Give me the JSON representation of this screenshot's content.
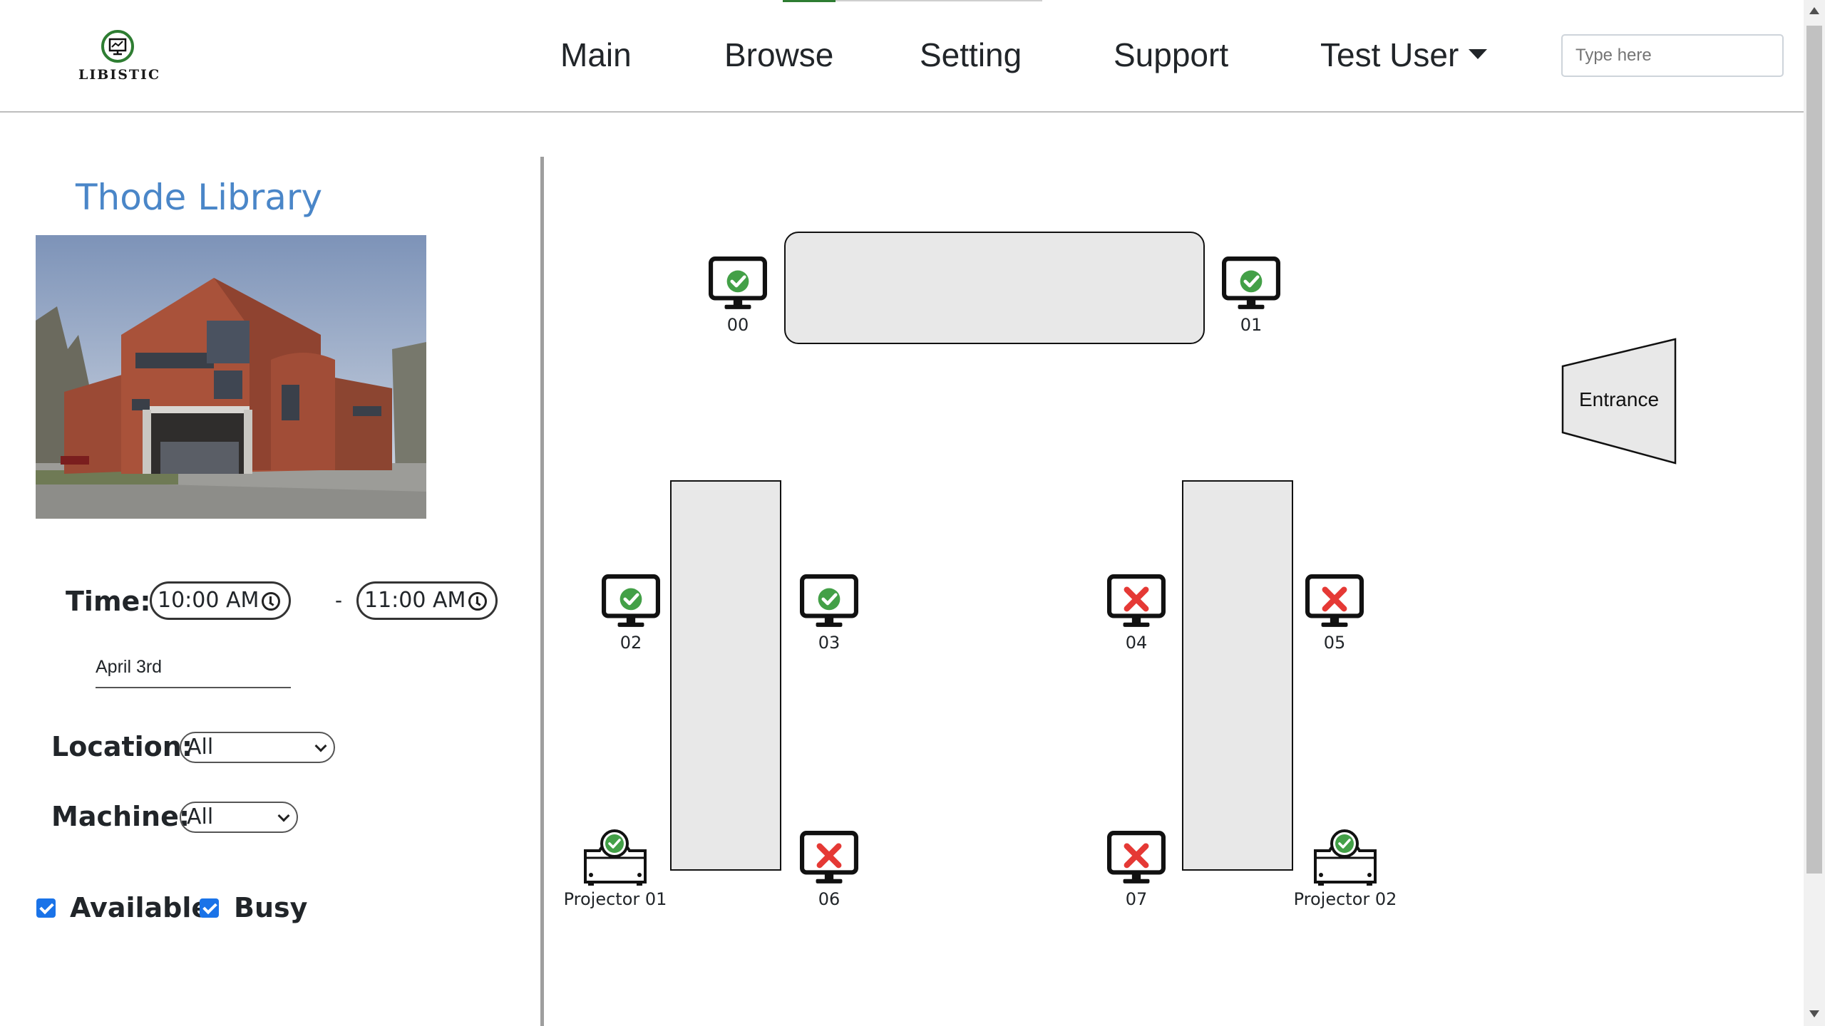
{
  "app": {
    "logo_text": "LIBISTIC"
  },
  "nav": {
    "items": [
      "Main",
      "Browse",
      "Setting",
      "Support"
    ],
    "user": "Test User",
    "search_placeholder": "Type here"
  },
  "library": {
    "name": "Thode Library"
  },
  "filters": {
    "time_label": "Time:",
    "start_time": "10:00 AM",
    "separator": "-",
    "end_time": "11:00 AM",
    "date": "April 3rd",
    "location_label": "Location:",
    "location_value": "All",
    "machine_label": "Machine:",
    "machine_value": "All",
    "available_label": "Available",
    "available_checked": true,
    "busy_label": "Busy",
    "busy_checked": true
  },
  "map": {
    "entrance_label": "Entrance",
    "stations": [
      {
        "label": "00",
        "type": "computer",
        "status": "available"
      },
      {
        "label": "01",
        "type": "computer",
        "status": "available"
      },
      {
        "label": "02",
        "type": "computer",
        "status": "available"
      },
      {
        "label": "03",
        "type": "computer",
        "status": "available"
      },
      {
        "label": "04",
        "type": "computer",
        "status": "busy"
      },
      {
        "label": "05",
        "type": "computer",
        "status": "busy"
      },
      {
        "label": "Projector 01",
        "type": "projector",
        "status": "available"
      },
      {
        "label": "06",
        "type": "computer",
        "status": "busy"
      },
      {
        "label": "07",
        "type": "computer",
        "status": "busy"
      },
      {
        "label": "Projector 02",
        "type": "projector",
        "status": "available"
      }
    ]
  },
  "colors": {
    "available": "#43a047",
    "busy": "#e53935",
    "title_blue": "#4a86c8",
    "checkbox": "#1a73e8"
  }
}
